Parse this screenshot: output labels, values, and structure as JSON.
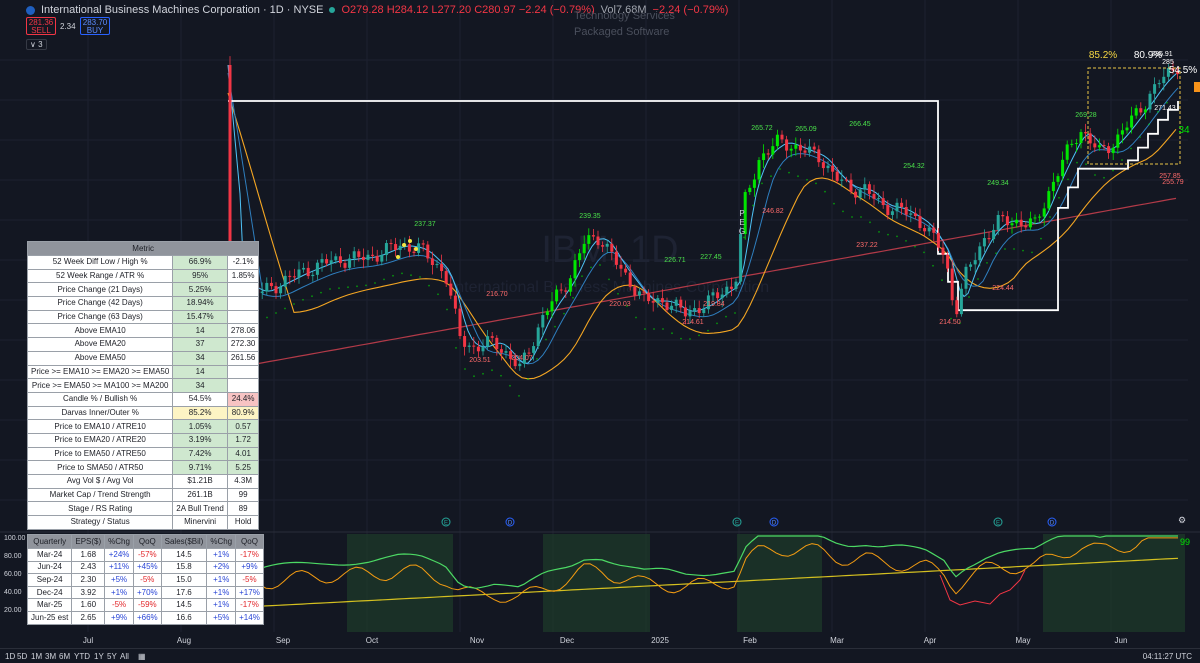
{
  "header": {
    "title": "International Business Machines Corporation · 1D · NYSE",
    "ohlc": "O279.28 H284.12 L277.20 C280.97 −2.24 (−0.79%)",
    "volume": "Vol7.68M",
    "change": "−2.24 (−0.79%)",
    "sell_price": "281.36",
    "sell_label": "SELL",
    "spread": "2.34",
    "buy_price": "283.70",
    "buy_label": "BUY",
    "indicators_collapsed": "∨ 3"
  },
  "sector": "Technology Services",
  "industry": "Packaged Software",
  "watermark": {
    "symbol": "IBM, 1D",
    "name": "International Business Machines Corporation"
  },
  "metrics_table": {
    "header": "Metric",
    "rows": [
      [
        "52 Week Diff Low / High %",
        "66.9%",
        "-2.1%"
      ],
      [
        "52 Week Range / ATR %",
        "95%",
        "1.85%"
      ],
      [
        "Price Change (21 Days)",
        "5.25%",
        ""
      ],
      [
        "Price Change (42 Days)",
        "18.94%",
        ""
      ],
      [
        "Price Change (63 Days)",
        "15.47%",
        ""
      ],
      [
        "Above EMA10",
        "14",
        "278.06"
      ],
      [
        "Above EMA20",
        "37",
        "272.30"
      ],
      [
        "Above EMA50",
        "34",
        "261.56"
      ],
      [
        "Price >= EMA10 >= EMA20 >= EMA50",
        "14",
        ""
      ],
      [
        "Price >= EMA50 >= MA100 >= MA200",
        "34",
        ""
      ],
      [
        "Candle % / Bullish %",
        "54.5%",
        "24.4%"
      ],
      [
        "Darvas Inner/Outer %",
        "85.2%",
        "80.9%"
      ],
      [
        "Price to EMA10 / ATRE10",
        "1.05%",
        "0.57"
      ],
      [
        "Price to EMA20 / ATRE20",
        "3.19%",
        "1.72"
      ],
      [
        "Price to EMA50 / ATRE50",
        "7.42%",
        "4.01"
      ],
      [
        "Price to SMA50 / ATR50",
        "9.71%",
        "5.25"
      ],
      [
        "Avg Vol $ / Avg Vol",
        "$1.21B",
        "4.3M"
      ],
      [
        "Market Cap / Trend Strength",
        "261.1B",
        "99"
      ],
      [
        "Stage / RS Rating",
        "2A Bull Trend",
        "89"
      ],
      [
        "Strategy / Status",
        "Minervini",
        "Hold"
      ]
    ],
    "cell_colors": [
      [
        "g",
        ""
      ],
      [
        "g",
        ""
      ],
      [
        "g",
        ""
      ],
      [
        "g",
        ""
      ],
      [
        "g",
        ""
      ],
      [
        "g",
        ""
      ],
      [
        "g",
        ""
      ],
      [
        "g",
        ""
      ],
      [
        "g",
        ""
      ],
      [
        "g",
        ""
      ],
      [
        "",
        "r"
      ],
      [
        "y",
        "y"
      ],
      [
        "g",
        "g"
      ],
      [
        "g",
        "g"
      ],
      [
        "g",
        "g"
      ],
      [
        "g",
        "g"
      ],
      [
        "",
        ""
      ],
      [
        "",
        ""
      ],
      [
        "",
        ""
      ],
      [
        "",
        ""
      ]
    ]
  },
  "earnings_table": {
    "headers": [
      "Quarterly",
      "EPS($)",
      "%Chg",
      "QoQ",
      "Sales($Bil)",
      "%Chg",
      "QoQ"
    ],
    "rows": [
      [
        "Mar-24",
        "1.68",
        "+24%",
        "-57%",
        "14.5",
        "+1%",
        "-17%"
      ],
      [
        "Jun-24",
        "2.43",
        "+11%",
        "+45%",
        "15.8",
        "+2%",
        "+9%"
      ],
      [
        "Sep-24",
        "2.30",
        "+5%",
        "-5%",
        "15.0",
        "+1%",
        "-5%"
      ],
      [
        "Dec-24",
        "3.92",
        "+1%",
        "+70%",
        "17.6",
        "+1%",
        "+17%"
      ],
      [
        "Mar-25",
        "1.60",
        "-5%",
        "-59%",
        "14.5",
        "+1%",
        "-17%"
      ],
      [
        "Jun-25 est",
        "2.65",
        "+9%",
        "+66%",
        "16.6",
        "+5%",
        "+14%"
      ]
    ]
  },
  "price_annotations": [
    {
      "label": "237.37",
      "date": "Oct",
      "type": "high"
    },
    {
      "label": "239.35",
      "date": "Dec",
      "type": "high"
    },
    {
      "label": "226.71",
      "date": "Jan",
      "type": "high"
    },
    {
      "label": "227.45",
      "date": "Jan",
      "type": "high"
    },
    {
      "label": "265.72",
      "date": "Feb",
      "type": "high"
    },
    {
      "label": "265.09",
      "date": "Feb",
      "type": "high"
    },
    {
      "label": "266.45",
      "date": "Mar",
      "type": "high"
    },
    {
      "label": "254.32",
      "date": "Mar",
      "type": "high"
    },
    {
      "label": "249.34",
      "date": "Apr",
      "type": "high"
    },
    {
      "label": "269.28",
      "date": "May",
      "type": "high"
    },
    {
      "label": "286.91",
      "date": "Jun",
      "type": "high"
    },
    {
      "label": "285",
      "date": "Jun",
      "type": "high"
    },
    {
      "label": "271.43",
      "date": "Jun",
      "type": "high"
    },
    {
      "label": "216.70",
      "date": "Nov",
      "type": "low"
    },
    {
      "label": "203.51",
      "date": "Nov",
      "type": "low"
    },
    {
      "label": "204.07",
      "date": "Nov",
      "type": "low"
    },
    {
      "label": "220.03",
      "date": "Dec",
      "type": "low"
    },
    {
      "label": "214.61",
      "date": "Jan",
      "type": "low"
    },
    {
      "label": "219.84",
      "date": "Jan",
      "type": "low"
    },
    {
      "label": "246.82",
      "date": "Feb",
      "type": "low"
    },
    {
      "label": "237.22",
      "date": "Mar",
      "type": "low"
    },
    {
      "label": "214.50",
      "date": "Apr",
      "type": "low"
    },
    {
      "label": "224.44",
      "date": "Apr",
      "type": "low"
    },
    {
      "label": "257.85",
      "date": "Jun",
      "type": "low"
    },
    {
      "label": "255.79",
      "date": "Jun",
      "type": "low"
    }
  ],
  "peg_label": "PEG",
  "darvas_labels": [
    "85.2%",
    "80.9%"
  ],
  "right_labels": [
    "54.5%",
    "34"
  ],
  "x_axis": [
    "Jul",
    "Aug",
    "Sep",
    "Oct",
    "Nov",
    "Dec",
    "2025",
    "Feb",
    "Mar",
    "Apr",
    "May",
    "Jun"
  ],
  "rs_axis": [
    "100.00",
    "80.00",
    "60.00",
    "40.00",
    "20.00"
  ],
  "rs_value": "99",
  "event_markers": [
    "E",
    "D",
    "E",
    "D",
    "E",
    "D"
  ],
  "timeframes": [
    "1D",
    "5D",
    "1M",
    "3M",
    "6M",
    "YTD",
    "1Y",
    "5Y",
    "All"
  ],
  "clock": "04:11:27 UTC",
  "colors": {
    "background": "#131722",
    "up_candle": "#26a69a",
    "green_bright": "#00e600",
    "red_candle": "#f23645",
    "stop_line": "#ffffff",
    "ema_fast": "#4fc3f7",
    "ema_slow": "#f4a623",
    "ma200": "#b23a48"
  }
}
